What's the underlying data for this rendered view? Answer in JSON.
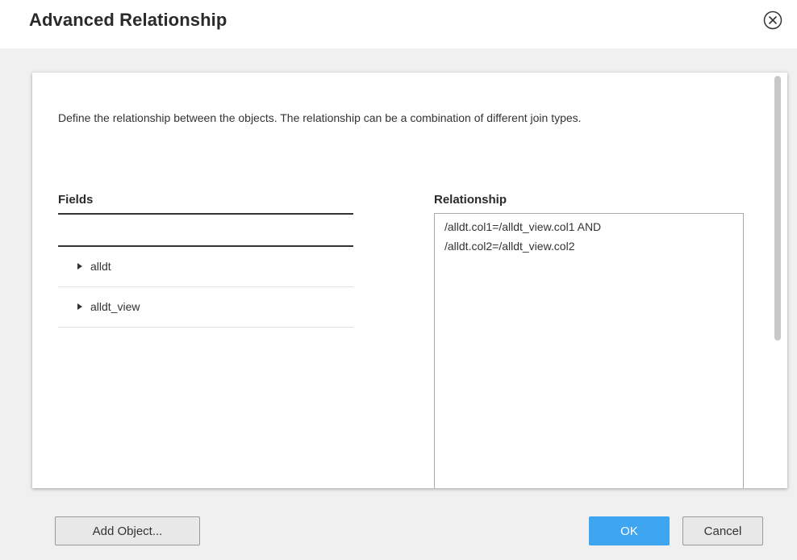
{
  "dialog": {
    "title": "Advanced Relationship",
    "close_icon": "close-circle-icon"
  },
  "panel": {
    "description": "Define the relationship between the objects. The relationship can be a combination of different join types.",
    "fields": {
      "header": "Fields",
      "filter_value": "",
      "items": [
        {
          "label": "alldt",
          "expanded": false,
          "icon": "expand-triangle-icon"
        },
        {
          "label": "alldt_view",
          "expanded": false,
          "icon": "expand-triangle-icon"
        }
      ]
    },
    "relationship": {
      "header": "Relationship",
      "value": "/alldt.col1=/alldt_view.col1 AND\n/alldt.col2=/alldt_view.col2"
    }
  },
  "footer": {
    "add_object_label": "Add Object...",
    "ok_label": "OK",
    "cancel_label": "Cancel"
  },
  "colors": {
    "accent": "#3ea5f0",
    "body_background": "#f0f0f0",
    "panel_background": "#ffffff"
  }
}
